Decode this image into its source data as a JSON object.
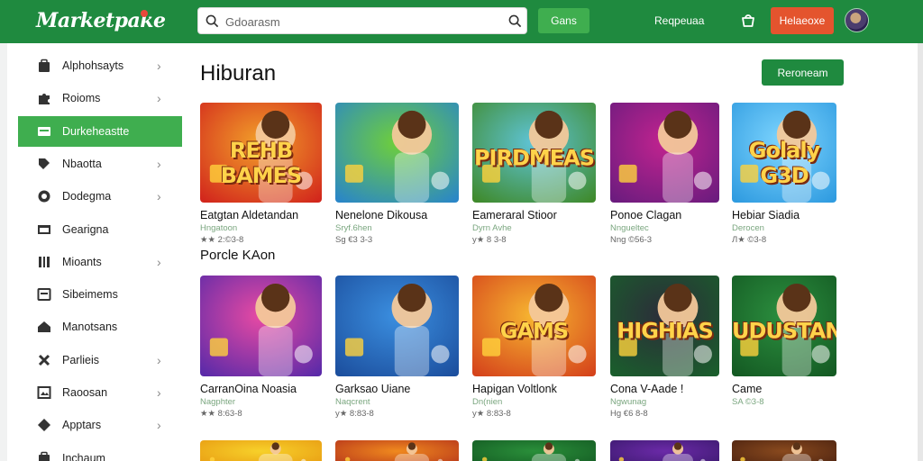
{
  "header": {
    "logo": "Marketpake",
    "search_placeholder": "Gdoarasm",
    "search_button": "Gans",
    "link": "Reqpeuaa",
    "signup_button": "Helaeoxe"
  },
  "sidebar": {
    "items": [
      {
        "label": "Alphohsayts",
        "icon": "bag-icon",
        "chevron": true
      },
      {
        "label": "Roioms",
        "icon": "puzzle-icon",
        "chevron": true
      },
      {
        "label": "Durkeheastte",
        "icon": "card-icon",
        "chevron": false,
        "active": true
      },
      {
        "label": "Nbaotta",
        "icon": "tag-icon",
        "chevron": true
      },
      {
        "label": "Dodegma",
        "icon": "target-icon",
        "chevron": true
      },
      {
        "label": "Gearigna",
        "icon": "window-icon",
        "chevron": false
      },
      {
        "label": "Mioants",
        "icon": "sliders-icon",
        "chevron": true
      },
      {
        "label": "Sibeimems",
        "icon": "box-icon",
        "chevron": false
      },
      {
        "label": "Manotsans",
        "icon": "house-icon",
        "chevron": false
      },
      {
        "label": "Parlieis",
        "icon": "cross-icon",
        "chevron": true
      },
      {
        "label": "Raoosan",
        "icon": "image-icon",
        "chevron": true
      },
      {
        "label": "Apptars",
        "icon": "diamond-icon",
        "chevron": true
      },
      {
        "label": "Inchaum",
        "icon": "bag-icon",
        "chevron": false
      }
    ]
  },
  "main": {
    "title": "Hiburan",
    "action_button": "Reroneam",
    "section2_title": "Porcle KAon",
    "row1": [
      {
        "title": "Eatgtan Aldetandan",
        "category": "Hngatoon",
        "price": "★★ 2:©3-8",
        "art": "REHB BAMES",
        "c1": "#f2a12a",
        "c2": "#d2261c"
      },
      {
        "title": "Nenelone Dikousa",
        "category": "Sryf.6hen",
        "price": "Sg €3 3-3",
        "art": "",
        "c1": "#6fcf3a",
        "c2": "#2a86c8"
      },
      {
        "title": "Eameraral Stioor",
        "category": "Dyrn Avhe",
        "price": "у★ 8 3-8",
        "art": "PIRDMEAS",
        "c1": "#5fc4d8",
        "c2": "#3f8a2b"
      },
      {
        "title": "Ponoe Clagan",
        "category": "Nngueltec",
        "price": "Nng ©56-3",
        "art": "",
        "c1": "#c1238f",
        "c2": "#6b1c7e"
      },
      {
        "title": "Hebiar Siadia",
        "category": "Derocen",
        "price": "Л★ ©3-8",
        "art": "Golaly G3D",
        "c1": "#7fd6ff",
        "c2": "#2f9be0"
      }
    ],
    "row2": [
      {
        "title": "CarranOina Noasia",
        "category": "Nagphter",
        "price": "★★ 8:63-8",
        "art": "",
        "c1": "#e84aa3",
        "c2": "#5a2aa8"
      },
      {
        "title": "Garksao Uiane",
        "category": "Naqcrent",
        "price": "у★ 8:83-8",
        "art": "",
        "c1": "#3b8fe0",
        "c2": "#1c4f9e"
      },
      {
        "title": "Hapigan Voltlonk",
        "category": "Dn(nien",
        "price": "у★ 8:83-8",
        "art": "GAMS",
        "c1": "#f7b731",
        "c2": "#d5431b"
      },
      {
        "title": "Cona V-Aade !",
        "category": "Ngwunag",
        "price": "Hg €6 8-8",
        "art": "HIGHIAS",
        "c1": "#2c2c3a",
        "c2": "#1a5e2c"
      },
      {
        "title": "Came",
        "category": "SA ©3-8",
        "price": "",
        "art": "UDUSTAN",
        "c1": "#2c8f3f",
        "c2": "#145a23"
      }
    ],
    "row3": [
      {
        "c1": "#f7d12a",
        "c2": "#e89a12"
      },
      {
        "c1": "#f08a1e",
        "c2": "#b5331b"
      },
      {
        "c1": "#2a8f3a",
        "c2": "#145a23"
      },
      {
        "c1": "#6b2aa8",
        "c2": "#3c1a6e"
      },
      {
        "c1": "#8a4a1e",
        "c2": "#4b2210"
      }
    ]
  },
  "colors": {
    "brand": "#1f8a3f",
    "accent_green": "#3fae4f",
    "accent_red": "#e4542e"
  }
}
